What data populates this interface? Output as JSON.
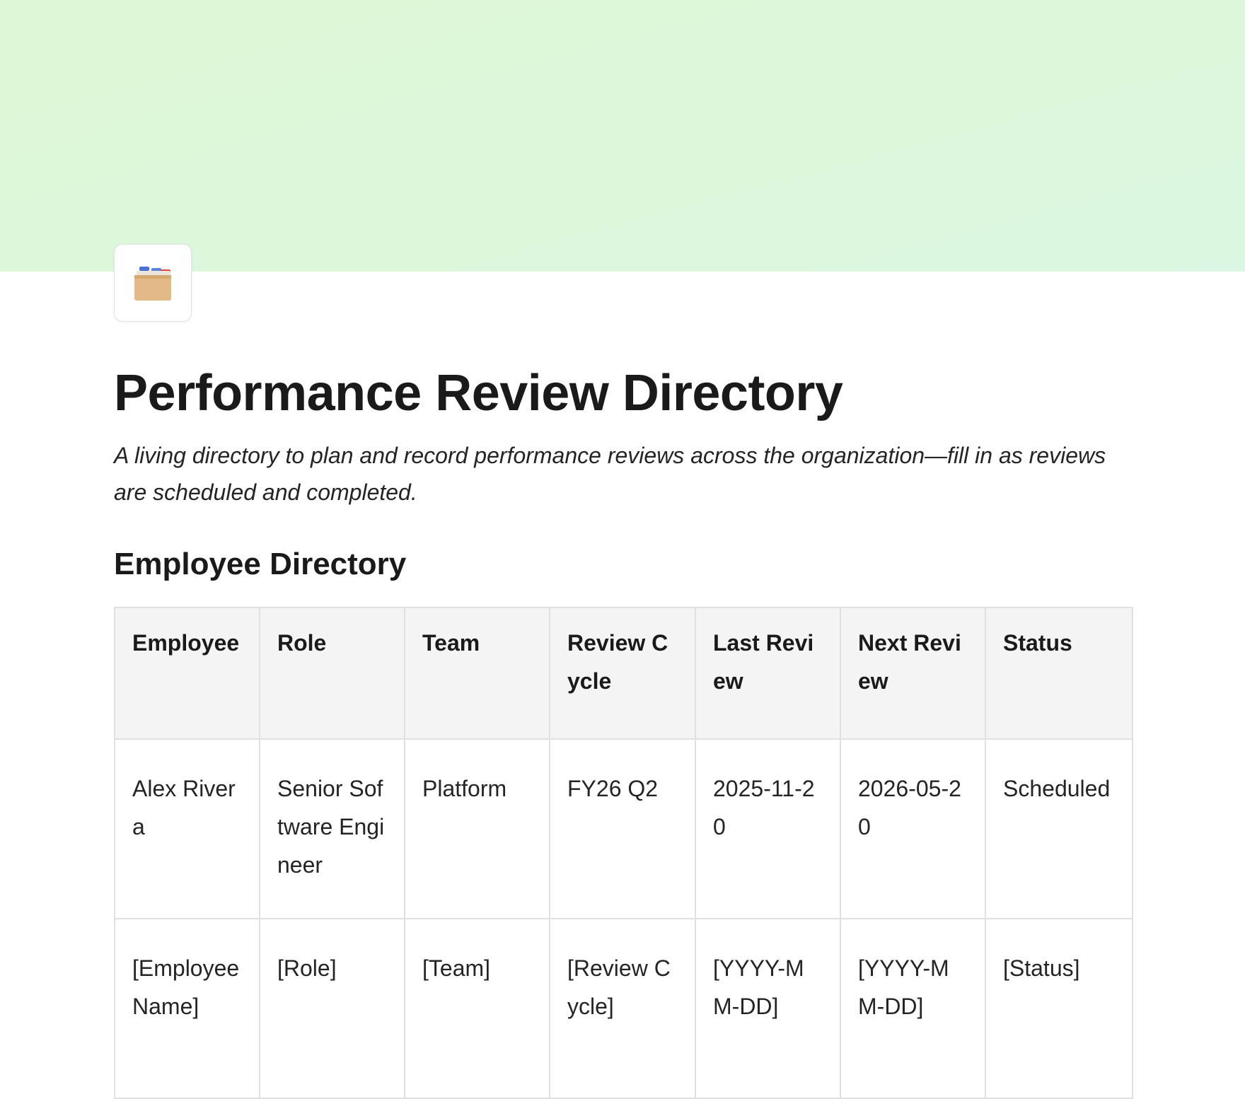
{
  "page": {
    "title": "Performance Review Directory",
    "description": "A living directory to plan and record performance reviews across the organization—fill in as reviews are scheduled and completed.",
    "icon": "card-file-box-icon"
  },
  "colors": {
    "cover_gradient_start": "#ddf7d4",
    "cover_gradient_end": "#dbf7e1",
    "table_header_bg": "#f4f4f4",
    "table_border": "#e0e0e0"
  },
  "section": {
    "heading": "Employee Directory"
  },
  "table": {
    "headers": [
      "Employee",
      "Role",
      "Team",
      "Review Cycle",
      "Last Review",
      "Next Review",
      "Status"
    ],
    "rows": [
      [
        "Alex Rivera",
        "Senior Software Engineer",
        "Platform",
        "FY26 Q2",
        "2025-11-20",
        "2026-05-20",
        "Scheduled"
      ],
      [
        "[Employee Name]",
        "[Role]",
        "[Team]",
        "[Review Cycle]",
        "[YYYY-MM-DD]",
        "[YYYY-MM-DD]",
        "[Status]"
      ]
    ]
  }
}
